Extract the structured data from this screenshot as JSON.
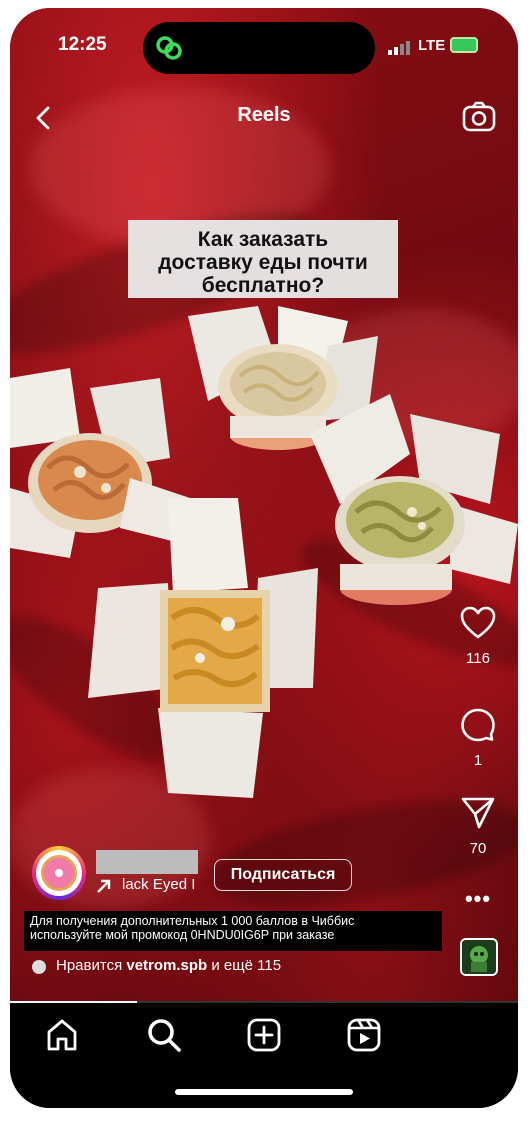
{
  "status_bar": {
    "time": "12:25",
    "network": "LTE"
  },
  "header": {
    "title": "Reels"
  },
  "video": {
    "overlay_text": [
      "Как заказать",
      "доставку еды почти",
      "бесплатно?"
    ]
  },
  "actions": {
    "like_count": "116",
    "comment_count": "1",
    "share_count": "70"
  },
  "author": {
    "audio_label": "lack Eyed I",
    "follow_label": "Подписаться"
  },
  "caption": {
    "line1": "Для получения дополнительных 1 000 баллов в Чиббис",
    "line2": "используйте мой промокод 0HNDU0IG6P при заказе"
  },
  "likes": {
    "prefix": "Нравится ",
    "user": "vetrom.spb",
    "suffix": " и ещё 115"
  },
  "progress": {
    "fraction": 0.25
  },
  "icons": {
    "back": "chevron-left-icon",
    "camera": "camera-icon",
    "like": "heart-icon",
    "comment": "comment-icon",
    "share": "send-icon",
    "more": "more-icon",
    "home": "home-icon",
    "search": "search-icon",
    "create": "plus-square-icon",
    "reels": "reels-icon"
  },
  "colors": {
    "battery": "#35c759",
    "island_icon": "#3ddc5a",
    "background": "#6e0d12"
  }
}
